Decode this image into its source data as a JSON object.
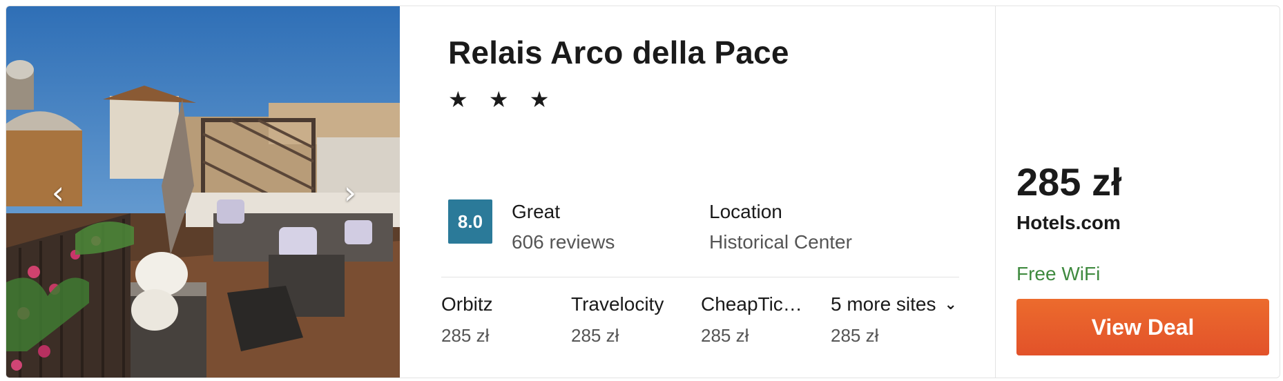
{
  "hotel": {
    "name": "Relais Arco della Pace",
    "stars": "★ ★ ★"
  },
  "gallery": {
    "prev_icon": "chevron-left-icon",
    "next_icon": "chevron-right-icon",
    "prev_glyph": "‹",
    "next_glyph": "›"
  },
  "rating": {
    "score": "8.0",
    "word": "Great",
    "reviews": "606 reviews",
    "badge_color": "#2b7a99"
  },
  "location": {
    "label": "Location",
    "value": "Historical Center"
  },
  "providers": [
    {
      "name": "Orbitz",
      "price": "285 zł"
    },
    {
      "name": "Travelocity",
      "price": "285 zł"
    },
    {
      "name": "CheapTic…",
      "price": "285 zł"
    },
    {
      "name": "5 more sites",
      "price": "285 zł",
      "icon": "chevron-down-icon",
      "glyph": "⌄"
    }
  ],
  "deal": {
    "price": "285 zł",
    "provider": "Hotels.com",
    "amenity": "Free WiFi",
    "button_label": "View Deal",
    "button_color": "#e85f2b",
    "amenity_color": "#3f8a3f"
  }
}
